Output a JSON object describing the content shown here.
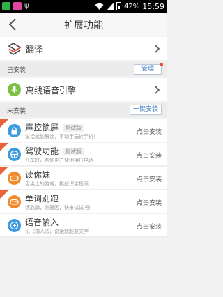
{
  "status_bar": {
    "battery": "42%",
    "time": "15:59"
  },
  "header": {
    "title": "扩展功能"
  },
  "translate": {
    "label": "翻译"
  },
  "installed_section": {
    "label": "已安装",
    "button_label": "管理"
  },
  "installed": [
    {
      "name": "离线语音引擎",
      "icon": "microphone-icon",
      "icon_color": "#7dbf45"
    }
  ],
  "uninstalled_section": {
    "label": "未安装",
    "button_label": "一键安装"
  },
  "apps": [
    {
      "name": "声控锁屏",
      "tag": "测试版",
      "desc": "说话就能解锁，不动手玩转手机！",
      "action": "点击安装",
      "icon": "lock-icon",
      "icon_color": "#3d9be0"
    },
    {
      "name": "驾驶功能",
      "tag": "测试版",
      "desc": "开车时，帮你更方便地接打电话",
      "action": "点击安装",
      "icon": "steering-wheel-icon",
      "icon_color": "#3d9be0"
    },
    {
      "name": "读你妹",
      "tag": "",
      "desc": "舌尖上的游戏，挑战识字极限",
      "action": "点击安装",
      "icon": "gamepad-icon",
      "icon_color": "#f08a2c"
    },
    {
      "name": "单词别跑",
      "tag": "",
      "desc": "读品牌，测基因，快来试试吧！",
      "action": "点击安装",
      "icon": "gamepad-icon",
      "icon_color": "#f08a2c"
    },
    {
      "name": "语音输入",
      "tag": "",
      "desc": "讯飞输入法，说话就能变文字",
      "action": "点击安装",
      "icon": "voice-input-icon",
      "icon_color": "#3d9be0"
    }
  ],
  "colors": {
    "accent_blue": "#3b7cc4",
    "badge_red": "#e74c3c",
    "new_ribbon": "#e8623a"
  }
}
